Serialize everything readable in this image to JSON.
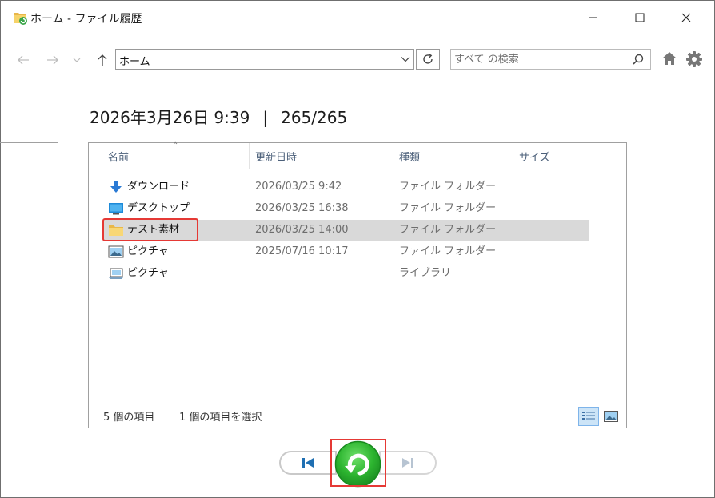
{
  "window": {
    "title": "ホーム - ファイル履歴"
  },
  "navigation": {
    "address": "ホーム",
    "search_placeholder": "すべて の検索"
  },
  "snapshot": {
    "datetime": "2026年3月26日 9:39",
    "separator": "|",
    "counter": "265/265"
  },
  "columns": [
    {
      "label": "名前"
    },
    {
      "label": "更新日時"
    },
    {
      "label": "種類"
    },
    {
      "label": "サイズ"
    }
  ],
  "rows": [
    {
      "icon": "download-arrow-icon",
      "name": "ダウンロード",
      "date": "2026/03/25 9:42",
      "type": "ファイル フォルダー",
      "selected": false
    },
    {
      "icon": "desktop-icon",
      "name": "デスクトップ",
      "date": "2026/03/25 16:38",
      "type": "ファイル フォルダー",
      "selected": false
    },
    {
      "icon": "folder-icon",
      "name": "テスト素材",
      "date": "2026/03/25 14:00",
      "type": "ファイル フォルダー",
      "selected": true
    },
    {
      "icon": "pictures-folder-icon",
      "name": "ピクチャ",
      "date": "2025/07/16 10:17",
      "type": "ファイル フォルダー",
      "selected": false
    },
    {
      "icon": "pictures-library-icon",
      "name": "ピクチャ",
      "date": "",
      "type": "ライブラリ",
      "selected": false
    }
  ],
  "status": {
    "item_count": "5 個の項目",
    "selected_count": "1 個の項目を選択"
  },
  "colors": {
    "accent_red": "#e53935",
    "restore_green": "#2db530",
    "selection": "#d9d9d9",
    "column_header_text": "#4c607a",
    "secondary_text": "#6d6d6d",
    "playback_icon_blue": "#1f6fb2"
  }
}
